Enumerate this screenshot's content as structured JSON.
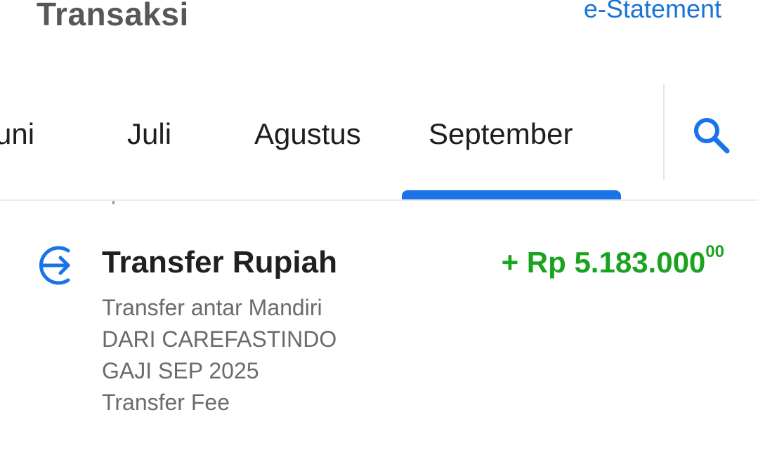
{
  "header": {
    "title": "Transaksi",
    "estatement_label": "e-Statement"
  },
  "tabs": [
    {
      "label": "Juni"
    },
    {
      "label": "Juli"
    },
    {
      "label": "Agustus"
    },
    {
      "label": "September",
      "selected": true
    }
  ],
  "search": {
    "icon": "search-icon"
  },
  "colors": {
    "accent": "#1a73e8",
    "credit": "#1aa31f",
    "title": "#5a5556"
  },
  "transactions": [
    {
      "icon": "transfer-in-icon",
      "title": "Transfer Rupiah",
      "amount_main": "+ Rp 5.183.000",
      "amount_decimal": "00",
      "description": [
        "Transfer antar Mandiri",
        "DARI CAREFASTINDO",
        "GAJI SEP 2025",
        "Transfer Fee"
      ]
    }
  ]
}
